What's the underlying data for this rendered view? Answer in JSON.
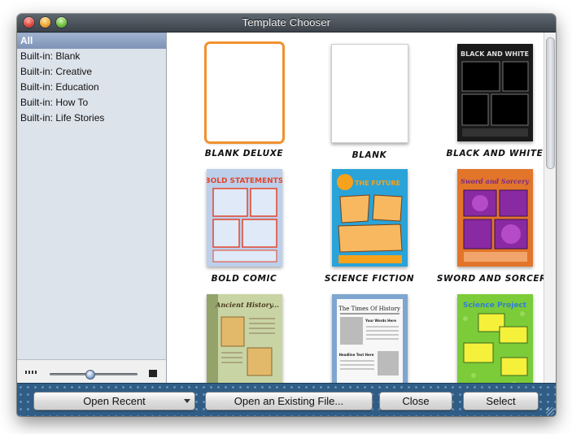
{
  "window": {
    "title": "Template Chooser"
  },
  "sidebar": {
    "items": [
      {
        "label": "All",
        "selected": true
      },
      {
        "label": "Built-in: Blank"
      },
      {
        "label": "Built-in: Creative"
      },
      {
        "label": "Built-in: Education"
      },
      {
        "label": "Built-in: How To"
      },
      {
        "label": "Built-in: Life Stories"
      }
    ],
    "zoom_fraction": 0.45
  },
  "templates": [
    {
      "name": "BLANK DELUXE",
      "selected": true
    },
    {
      "name": "BLANK"
    },
    {
      "name": "BLACK AND WHITE",
      "header_text": "BLACK AND WHITE"
    },
    {
      "name": "BOLD COMIC",
      "header_text": "BOLD STATEMENTS"
    },
    {
      "name": "SCIENCE FICTION",
      "header_text": "THE FUTURE"
    },
    {
      "name": "SWORD AND SORCERY",
      "header_text": "Sword and Sorcery"
    },
    {
      "name": "",
      "header_text": "Ancient History..."
    },
    {
      "name": "",
      "header_text": "The Times Of History",
      "sub1": "Your Words Here",
      "sub2": "Headline Text Here"
    },
    {
      "name": "",
      "header_text": "Science Project"
    }
  ],
  "buttons": {
    "open_recent": "Open Recent",
    "open_existing": "Open an Existing File...",
    "close": "Close",
    "select": "Select"
  },
  "colors": {
    "selection_orange": "#f0922e",
    "bottom_bar": "#2f5d86",
    "sidebar_selected": "#8a9fc0"
  }
}
